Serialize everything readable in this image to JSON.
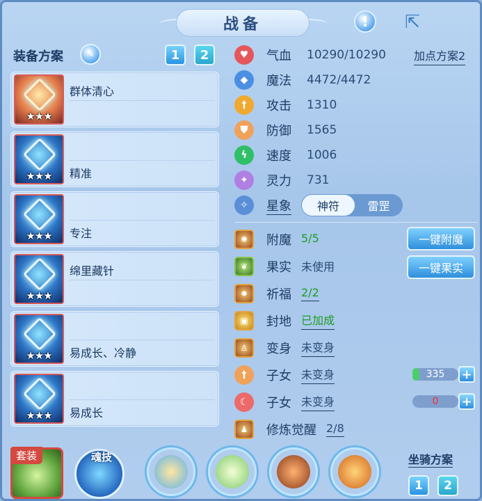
{
  "header": {
    "title": "战备",
    "info_icon": "exclamation-icon",
    "share_icon": "share-icon"
  },
  "equip_panel": {
    "title": "装备方案",
    "plan_buttons": [
      "1",
      "2"
    ],
    "cards": [
      {
        "name": "群体清心",
        "stars": "★★★"
      },
      {
        "name": "精准",
        "stars": "★★★"
      },
      {
        "name": "专注",
        "stars": "★★★"
      },
      {
        "name": "绵里藏针",
        "stars": "★★★"
      },
      {
        "name": "易成长、冷静",
        "stars": "★★★"
      },
      {
        "name": "易成长",
        "stars": "★★★"
      }
    ]
  },
  "attributes": {
    "add_plan_label": "加点方案2",
    "stats": [
      {
        "label": "气血",
        "value": "10290/10290",
        "color": "#e5575b",
        "icon": "heart-icon"
      },
      {
        "label": "魔法",
        "value": "4472/4472",
        "color": "#4a8fe3",
        "icon": "mana-icon"
      },
      {
        "label": "攻击",
        "value": "1310",
        "color": "#f0a92f",
        "icon": "sword-icon"
      },
      {
        "label": "防御",
        "value": "1565",
        "color": "#f0a25a",
        "icon": "shield-icon"
      },
      {
        "label": "速度",
        "value": "1006",
        "color": "#2fbf67",
        "icon": "speed-icon"
      },
      {
        "label": "灵力",
        "value": "731",
        "color": "#b07fe3",
        "icon": "spirit-icon"
      }
    ],
    "star_label": "星象",
    "star_options": [
      "神符",
      "雷罡"
    ]
  },
  "status": {
    "rows": [
      {
        "label": "附魔",
        "value": "5/5"
      },
      {
        "label": "果实",
        "value": "未使用"
      },
      {
        "label": "祈福",
        "value": "2/2"
      },
      {
        "label": "封地",
        "value": "已加成"
      },
      {
        "label": "变身",
        "value": "未变身"
      },
      {
        "label": "子女",
        "value": "未变身"
      },
      {
        "label": "子女",
        "value": "未变身"
      },
      {
        "label": "修炼觉醒",
        "value": "2/8"
      }
    ],
    "enchant_button": "一键附魔",
    "fruit_button": "一键果实",
    "child1_value": "335",
    "child2_value": "0",
    "child1_fill": 0.15,
    "child2_fill": 0
  },
  "bottom": {
    "suit_label": "套装",
    "soul_label": "魂技",
    "mount_title": "坐骑方案",
    "mount_buttons": [
      "1",
      "2"
    ]
  }
}
